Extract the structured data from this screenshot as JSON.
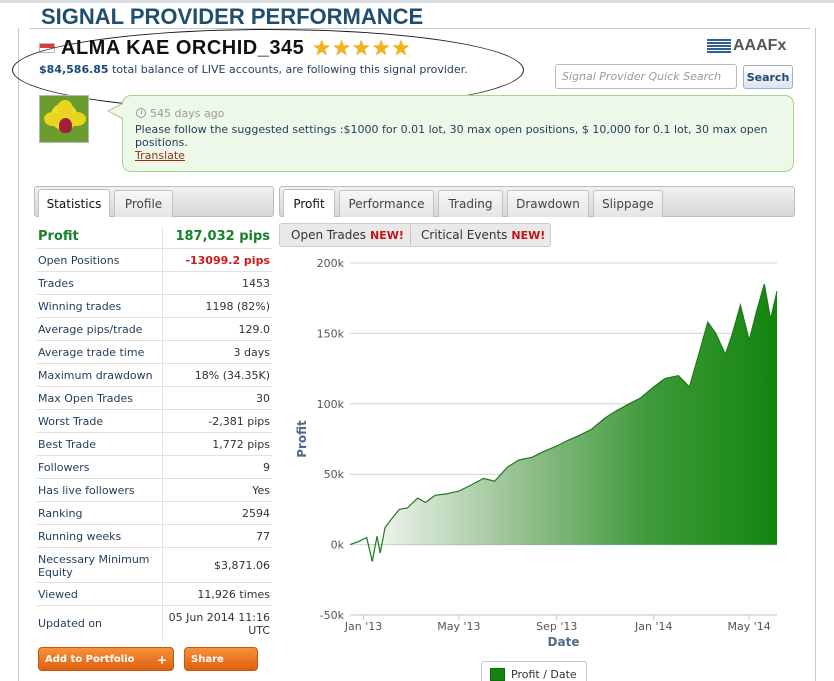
{
  "page_title": "SIGNAL PROVIDER PERFORMANCE",
  "provider": {
    "name": "ALMA KAE ORCHID_345",
    "stars": "★★★★★",
    "rating": 5,
    "balance": "$84,586.85",
    "balance_text": "total balance of LIVE accounts, are following this signal provider."
  },
  "brand": "AAAFx",
  "search": {
    "placeholder": "Signal Provider Quick Search",
    "button": "Search"
  },
  "message": {
    "time": "545 days ago",
    "text": "Please follow the suggested settings :$1000 for 0.01 lot, 30 max open positions, $ 10,000 for 0.1 lot, 30 max open positions.",
    "link": "Translate"
  },
  "left_tabs": [
    "Statistics",
    "Profile"
  ],
  "right_tabs": [
    "Profit",
    "Performance",
    "Trading",
    "Drawdown",
    "Slippage"
  ],
  "sub_tabs": [
    {
      "label": "Open Trades",
      "badge": "NEW!"
    },
    {
      "label": "Critical Events",
      "badge": "NEW!"
    }
  ],
  "stats": [
    {
      "label": "Profit",
      "value": "187,032 pips"
    },
    {
      "label": "Open Positions",
      "value": "-13099.2 pips"
    },
    {
      "label": "Trades",
      "value": "1453"
    },
    {
      "label": "Winning trades",
      "value": "1198 (82%)"
    },
    {
      "label": "Average pips/trade",
      "value": "129.0"
    },
    {
      "label": "Average trade time",
      "value": "3 days"
    },
    {
      "label": "Maximum drawdown",
      "value": "18% (34.35K)"
    },
    {
      "label": "Max Open Trades",
      "value": "30"
    },
    {
      "label": "Worst Trade",
      "value": "-2,381 pips"
    },
    {
      "label": "Best Trade",
      "value": "1,772 pips"
    },
    {
      "label": "Followers",
      "value": "9"
    },
    {
      "label": "Has live followers",
      "value": "Yes"
    },
    {
      "label": "Ranking",
      "value": "2594"
    },
    {
      "label": "Running weeks",
      "value": "77"
    },
    {
      "label": "Necessary Minimum Equity",
      "value": "$3,871.06"
    },
    {
      "label": "Viewed",
      "value": "11,926 times"
    },
    {
      "label": "Updated on",
      "value": "05 Jun 2014 11:16 UTC"
    }
  ],
  "buttons": {
    "portfolio": "Add to Portfolio",
    "portfolio_plus": "+",
    "share": "Share"
  },
  "colors": {
    "profit_green": "#19802a",
    "loss_red": "#cc1a1a",
    "title_blue": "#1f4e6e",
    "area_green": "#14850f"
  },
  "chart_data": {
    "type": "area",
    "xlabel": "Date",
    "ylabel": "Profit",
    "ylim": [
      -50000,
      200000
    ],
    "yticks": [
      -50000,
      0,
      50000,
      100000,
      150000,
      200000
    ],
    "ytick_labels": [
      "-50k",
      "0k",
      "50k",
      "100k",
      "150k",
      "200k"
    ],
    "xticks": [
      "2013-01",
      "2013-05",
      "2013-09",
      "2014-01",
      "2014-05"
    ],
    "xtick_labels": [
      "Jan '13",
      "May '13",
      "Sep '13",
      "Jan '14",
      "May '14"
    ],
    "xlim": [
      "2012-12-15",
      "2014-06-05"
    ],
    "grid": true,
    "legend": "bottom",
    "series": [
      {
        "name": "Profit / Date",
        "x": [
          "2012-12-15",
          "2012-12-25",
          "2013-01-05",
          "2013-01-12",
          "2013-01-18",
          "2013-01-22",
          "2013-01-28",
          "2013-02-05",
          "2013-02-15",
          "2013-02-25",
          "2013-03-10",
          "2013-03-20",
          "2013-04-01",
          "2013-04-15",
          "2013-05-01",
          "2013-05-15",
          "2013-06-01",
          "2013-06-15",
          "2013-07-01",
          "2013-07-15",
          "2013-08-01",
          "2013-08-15",
          "2013-09-01",
          "2013-09-15",
          "2013-10-01",
          "2013-10-15",
          "2013-11-01",
          "2013-11-15",
          "2013-12-01",
          "2013-12-15",
          "2014-01-01",
          "2014-01-15",
          "2014-02-01",
          "2014-02-15",
          "2014-03-01",
          "2014-03-10",
          "2014-03-20",
          "2014-04-01",
          "2014-04-10",
          "2014-04-20",
          "2014-05-01",
          "2014-05-10",
          "2014-05-20",
          "2014-05-28",
          "2014-06-05"
        ],
        "y": [
          0,
          2000,
          5000,
          -12000,
          6000,
          -6000,
          12000,
          18000,
          25000,
          26000,
          33000,
          30000,
          35000,
          36000,
          38000,
          42000,
          47000,
          45000,
          55000,
          60000,
          62000,
          66000,
          70000,
          74000,
          78000,
          82000,
          90000,
          95000,
          100000,
          104000,
          112000,
          118000,
          120000,
          112000,
          140000,
          158000,
          150000,
          135000,
          150000,
          170000,
          145000,
          165000,
          185000,
          160000,
          180000
        ]
      }
    ]
  }
}
